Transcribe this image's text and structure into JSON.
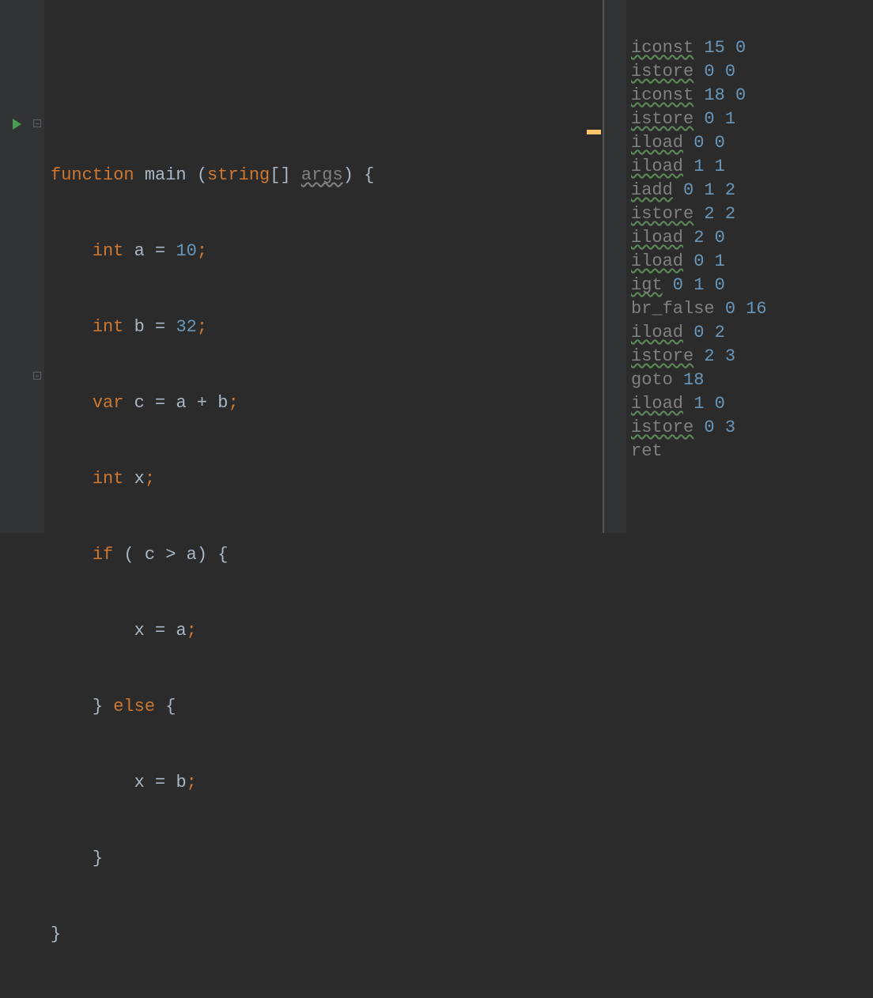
{
  "source": {
    "l1": {
      "kw_function": "function",
      "name": "main",
      "paren_open": "(",
      "kw_type": "string",
      "brackets": "[]",
      "param": "args",
      "paren_close": ")",
      "brace": "{"
    },
    "l2": {
      "kw": "int",
      "id": "a",
      "eq": "=",
      "num": "10",
      "semi": ";"
    },
    "l3": {
      "kw": "int",
      "id": "b",
      "eq": "=",
      "num": "32",
      "semi": ";"
    },
    "l4": {
      "kw": "var",
      "id": "c",
      "eq": "=",
      "expr_a": "a",
      "plus": "+",
      "expr_b": "b",
      "semi": ";"
    },
    "l5": {
      "kw": "int",
      "id": "x",
      "semi": ";"
    },
    "l6": {
      "kw": "if",
      "open": "(",
      "lhs": "c",
      "op": ">",
      "rhs": "a",
      "close": ")",
      "brace": "{"
    },
    "l7": {
      "id": "x",
      "eq": "=",
      "val": "a",
      "semi": ";"
    },
    "l8": {
      "close": "}",
      "kw": "else",
      "brace": "{"
    },
    "l9": {
      "id": "x",
      "eq": "=",
      "val": "b",
      "semi": ";"
    },
    "l10": {
      "close": "}"
    },
    "l11": {
      "close": "}"
    }
  },
  "bytecode": [
    {
      "op": "iconst",
      "args": "15 0",
      "wavy": true
    },
    {
      "op": "istore",
      "args": "0 0",
      "wavy": true
    },
    {
      "op": "iconst",
      "args": "18 0",
      "wavy": true
    },
    {
      "op": "istore",
      "args": "0 1",
      "wavy": true
    },
    {
      "op": "iload",
      "args": "0 0",
      "wavy": true
    },
    {
      "op": "iload",
      "args": "1 1",
      "wavy": true
    },
    {
      "op": "iadd",
      "args": "0 1 2",
      "wavy": true
    },
    {
      "op": "istore",
      "args": "2 2",
      "wavy": true
    },
    {
      "op": "iload",
      "args": "2 0",
      "wavy": true
    },
    {
      "op": "iload",
      "args": "0 1",
      "wavy": true
    },
    {
      "op": "igt",
      "args": "0 1 0",
      "wavy": true
    },
    {
      "op": "br_false",
      "args": "0 16",
      "wavy": false
    },
    {
      "op": "iload",
      "args": "0 2",
      "wavy": true
    },
    {
      "op": "istore",
      "args": "2 3",
      "wavy": true
    },
    {
      "op": "goto",
      "args": "18",
      "wavy": false
    },
    {
      "op": "iload",
      "args": "1 0",
      "wavy": true
    },
    {
      "op": "istore",
      "args": "0 3",
      "wavy": true
    },
    {
      "op": "ret",
      "args": "",
      "wavy": false
    }
  ]
}
